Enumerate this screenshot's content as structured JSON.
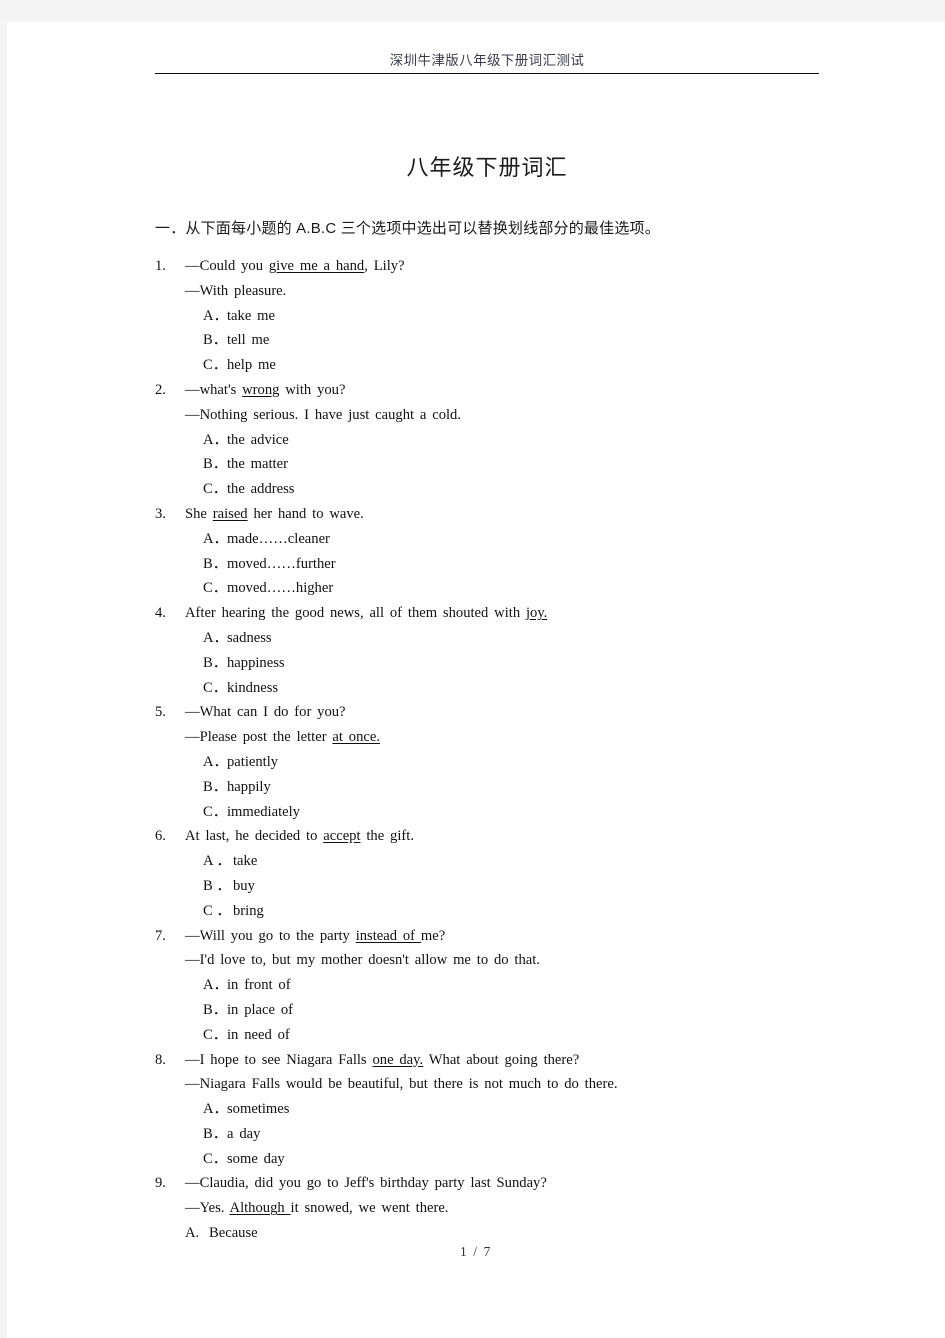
{
  "page": {
    "header_title": "深圳牛津版八年级下册词汇测试",
    "doc_title": "八年级下册词汇",
    "instruction": "一．从下面每小题的 A.B.C 三个选项中选出可以替换划线部分的最佳选项。",
    "footer": "1 / 7"
  },
  "questions": [
    {
      "num": "1.",
      "lines": [
        {
          "pre": "—Could you ",
          "underline": "give me a hand",
          "post": ", Lily?"
        },
        {
          "pre": "—With pleasure.",
          "underline": "",
          "post": ""
        }
      ],
      "options": [
        {
          "letter": "A．",
          "text": "take me"
        },
        {
          "letter": "B．",
          "text": "tell me"
        },
        {
          "letter": "C．",
          "text": "help me"
        }
      ]
    },
    {
      "num": "2.",
      "lines": [
        {
          "pre": "—what's ",
          "underline": "wrong",
          "post": " with you?"
        },
        {
          "pre": "—Nothing serious. I have just caught a cold.",
          "underline": "",
          "post": ""
        }
      ],
      "options": [
        {
          "letter": "A．",
          "text": "the advice"
        },
        {
          "letter": "B．",
          "text": "the matter"
        },
        {
          "letter": "C．",
          "text": "the address"
        }
      ]
    },
    {
      "num": "3.",
      "lines": [
        {
          "pre": "She ",
          "underline": "raised",
          "post": " her hand to wave."
        }
      ],
      "options": [
        {
          "letter": "A．",
          "text": "made……cleaner"
        },
        {
          "letter": "B．",
          "text": "moved……further"
        },
        {
          "letter": "C．",
          "text": "moved……higher"
        }
      ]
    },
    {
      "num": "4.",
      "lines": [
        {
          "pre": "After hearing the good news, all of them shouted with ",
          "underline": "joy.",
          "post": ""
        }
      ],
      "options": [
        {
          "letter": "A．",
          "text": "sadness"
        },
        {
          "letter": "B．",
          "text": "happiness"
        },
        {
          "letter": "C．",
          "text": "kindness"
        }
      ]
    },
    {
      "num": "5.",
      "lines": [
        {
          "pre": "—What can I do for you?",
          "underline": "",
          "post": ""
        },
        {
          "pre": "—Please post the letter ",
          "underline": "at once.",
          "post": ""
        }
      ],
      "options": [
        {
          "letter": "A．",
          "text": "patiently"
        },
        {
          "letter": "B．",
          "text": "happily"
        },
        {
          "letter": "C．",
          "text": "immediately"
        }
      ]
    },
    {
      "num": "6.",
      "lines": [
        {
          "pre": "At last, he decided to ",
          "underline": "accept",
          "post": " the gift."
        }
      ],
      "options": [
        {
          "letter": "A ．",
          "text": "take"
        },
        {
          "letter": "B ．",
          "text": "buy"
        },
        {
          "letter": "C ．",
          "text": "bring"
        }
      ]
    },
    {
      "num": "7.",
      "lines": [
        {
          "pre": "—Will you go to the party ",
          "underline": "instead of ",
          "post": "me?"
        },
        {
          "pre": "—I'd love to, but my mother doesn't allow me to do that.",
          "underline": "",
          "post": ""
        }
      ],
      "options": [
        {
          "letter": "A．",
          "text": "in front of"
        },
        {
          "letter": "B．",
          "text": "in place of"
        },
        {
          "letter": "C．",
          "text": "in need of"
        }
      ]
    },
    {
      "num": "8.",
      "lines": [
        {
          "pre": "—I hope to see Niagara Falls ",
          "underline": "one day.",
          "post": " What about going there?"
        },
        {
          "pre": "—Niagara Falls would be beautiful, but there is not much to do there.",
          "underline": "",
          "post": ""
        }
      ],
      "options": [
        {
          "letter": "A．",
          "text": "sometimes"
        },
        {
          "letter": "B．",
          "text": "a day"
        },
        {
          "letter": "C．",
          "text": "some day"
        }
      ]
    },
    {
      "num": "9.",
      "lines": [
        {
          "pre": "—Claudia, did you go to Jeff's birthday party last Sunday?",
          "underline": "",
          "post": ""
        },
        {
          "pre": "—Yes. ",
          "underline": "Although ",
          "post": "it snowed, we went there."
        }
      ],
      "options": [
        {
          "letter": "A.",
          "text": "Because",
          "narrow": true
        }
      ]
    }
  ]
}
